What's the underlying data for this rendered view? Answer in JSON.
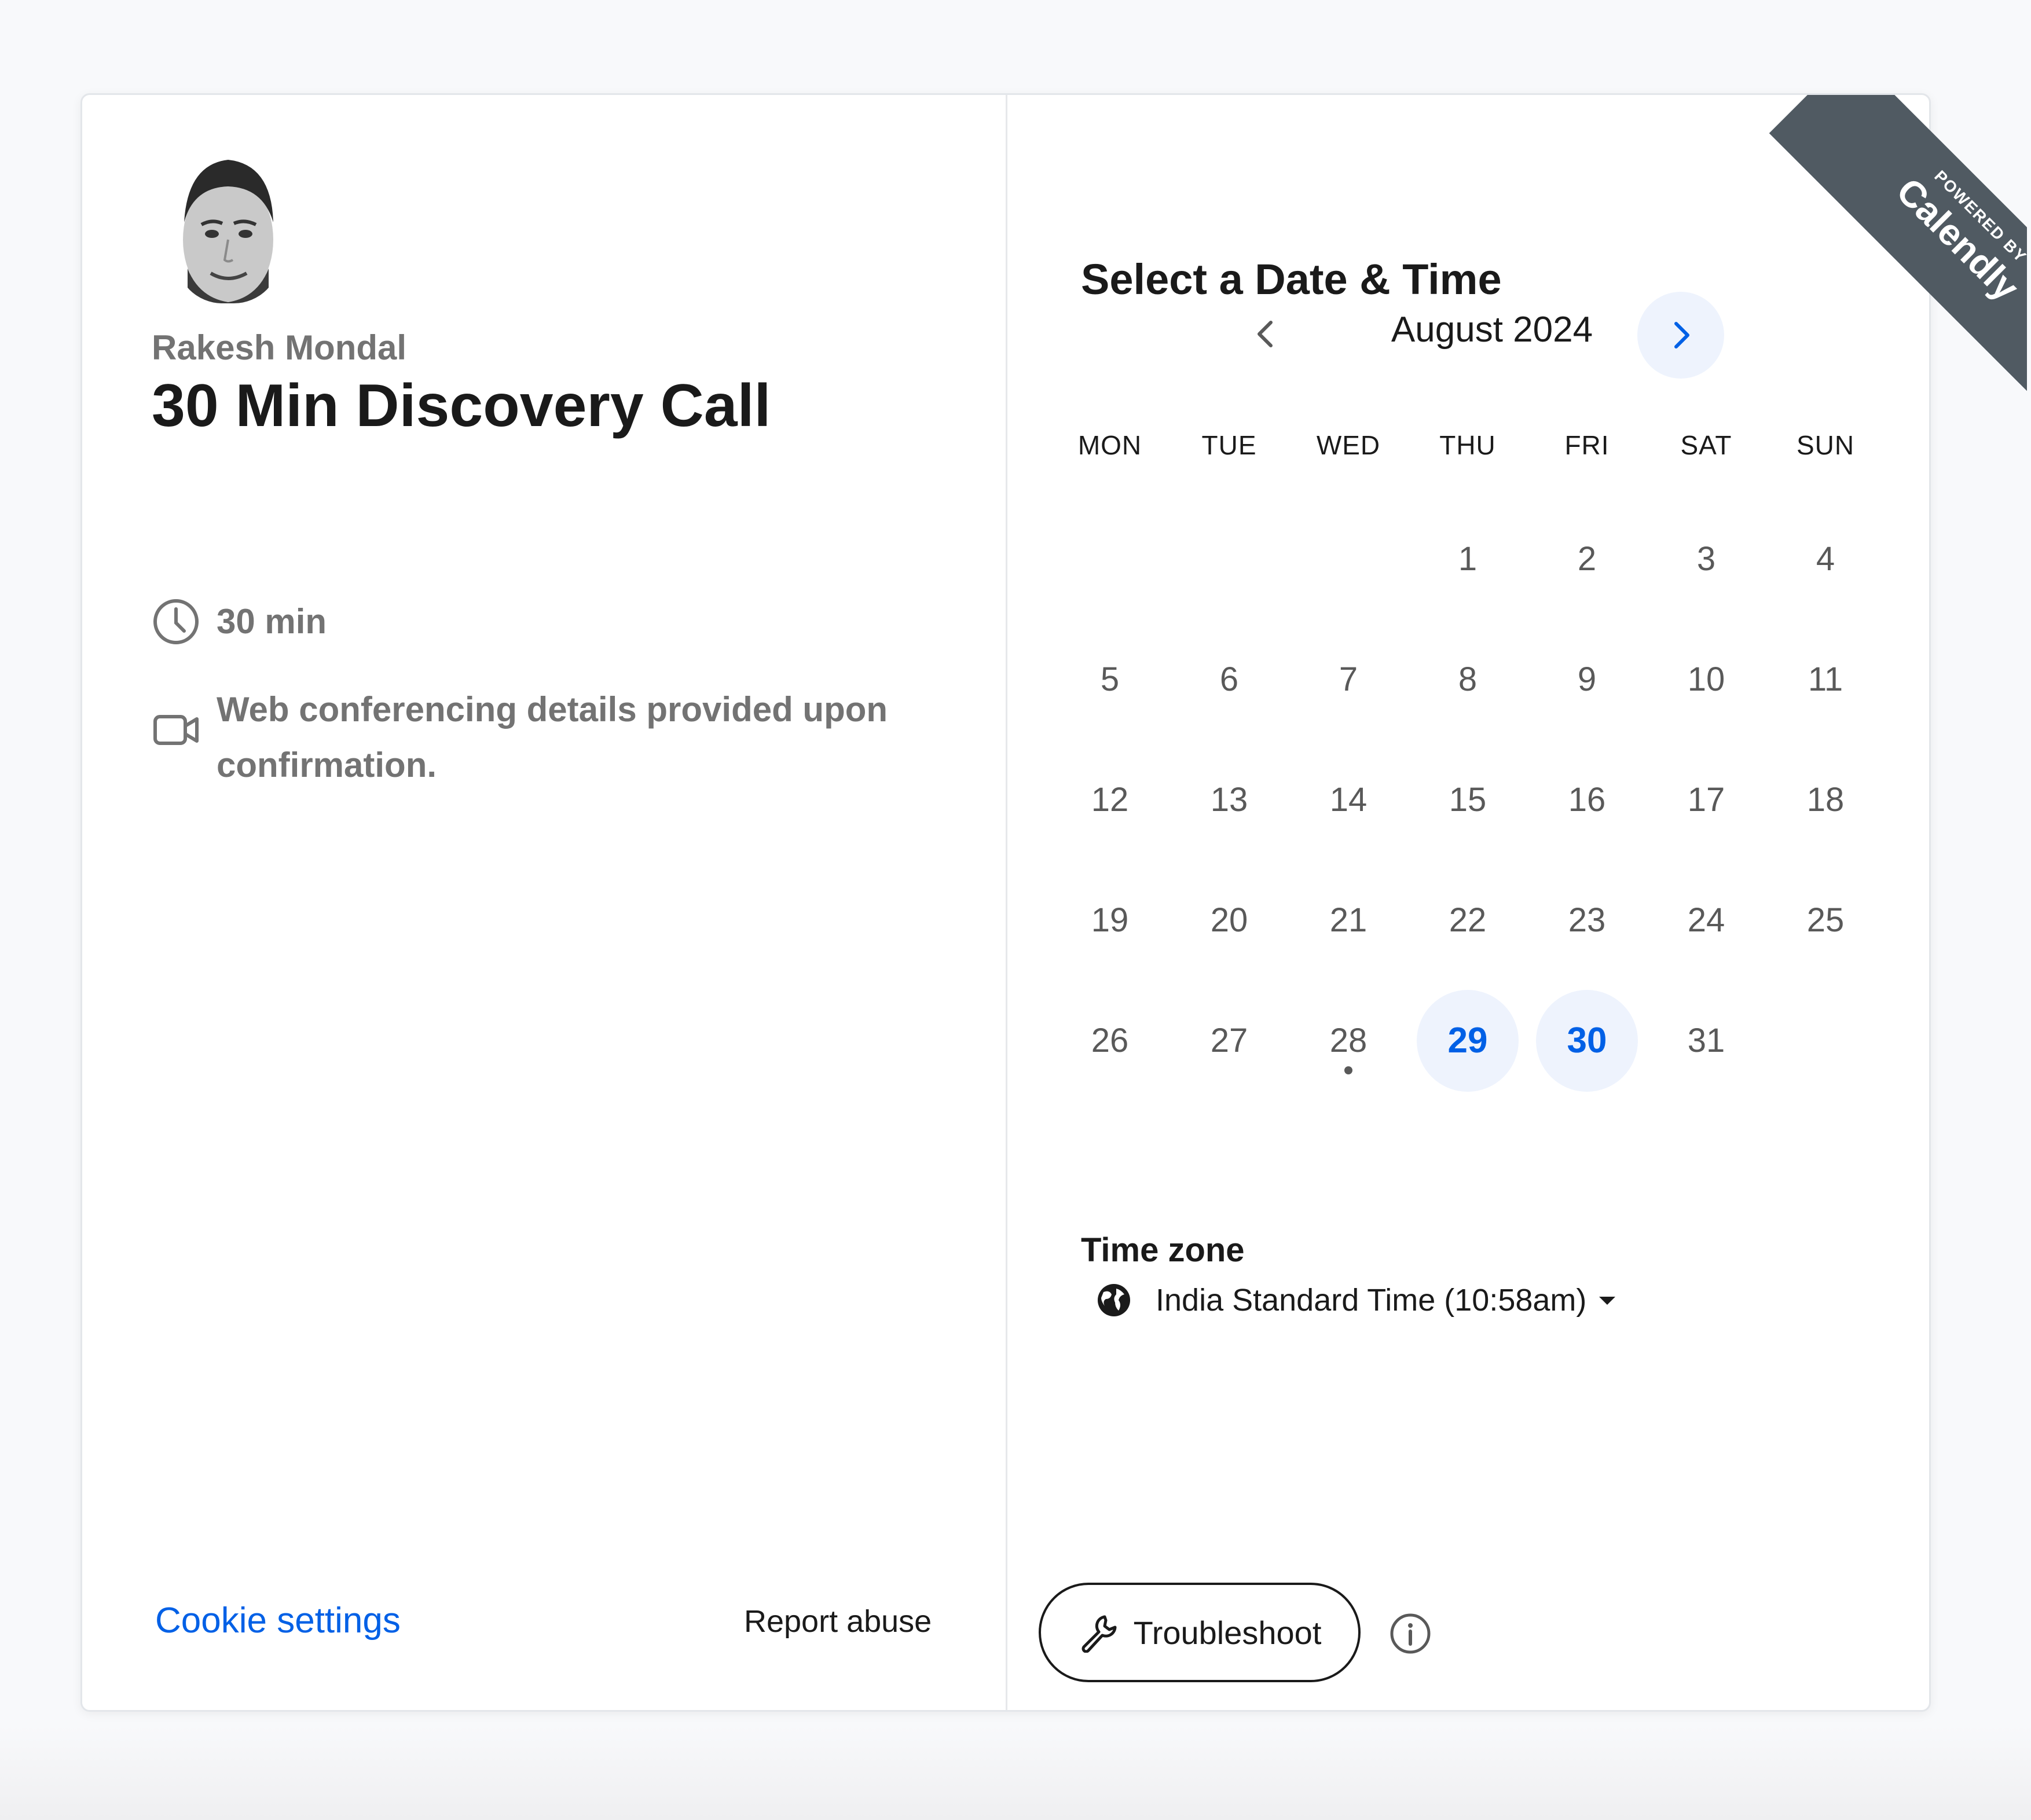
{
  "host": {
    "name": "Rakesh Mondal"
  },
  "event": {
    "title": "30 Min Discovery Call",
    "duration": "30 min",
    "location_line1": "Web conferencing details provided upon",
    "location_line2": "confirmation."
  },
  "footer": {
    "cookie_settings": "Cookie settings",
    "report_abuse": "Report abuse"
  },
  "calendar": {
    "heading": "Select a Date & Time",
    "month_label": "August 2024",
    "weekdays": [
      "MON",
      "TUE",
      "WED",
      "THU",
      "FRI",
      "SAT",
      "SUN"
    ],
    "first_weekday_index": 3,
    "days": [
      "1",
      "2",
      "3",
      "4",
      "5",
      "6",
      "7",
      "8",
      "9",
      "10",
      "11",
      "12",
      "13",
      "14",
      "15",
      "16",
      "17",
      "18",
      "19",
      "20",
      "21",
      "22",
      "23",
      "24",
      "25",
      "26",
      "27",
      "28",
      "29",
      "30",
      "31"
    ],
    "available_days": [
      "29",
      "30"
    ],
    "today": "28"
  },
  "timezone": {
    "label": "Time zone",
    "value": "India Standard Time (10:58am)"
  },
  "troubleshoot": {
    "label": "Troubleshoot"
  },
  "ribbon": {
    "small": "POWERED BY",
    "brand": "Calendly"
  },
  "colors": {
    "accent": "#0060e6",
    "available_bg": "#eef3fd",
    "ribbon": "#505a62"
  },
  "icons": [
    "clock-icon",
    "video-camera-icon",
    "chevron-left-icon",
    "chevron-right-icon",
    "globe-icon",
    "caret-down-icon",
    "wrench-icon",
    "info-icon"
  ]
}
